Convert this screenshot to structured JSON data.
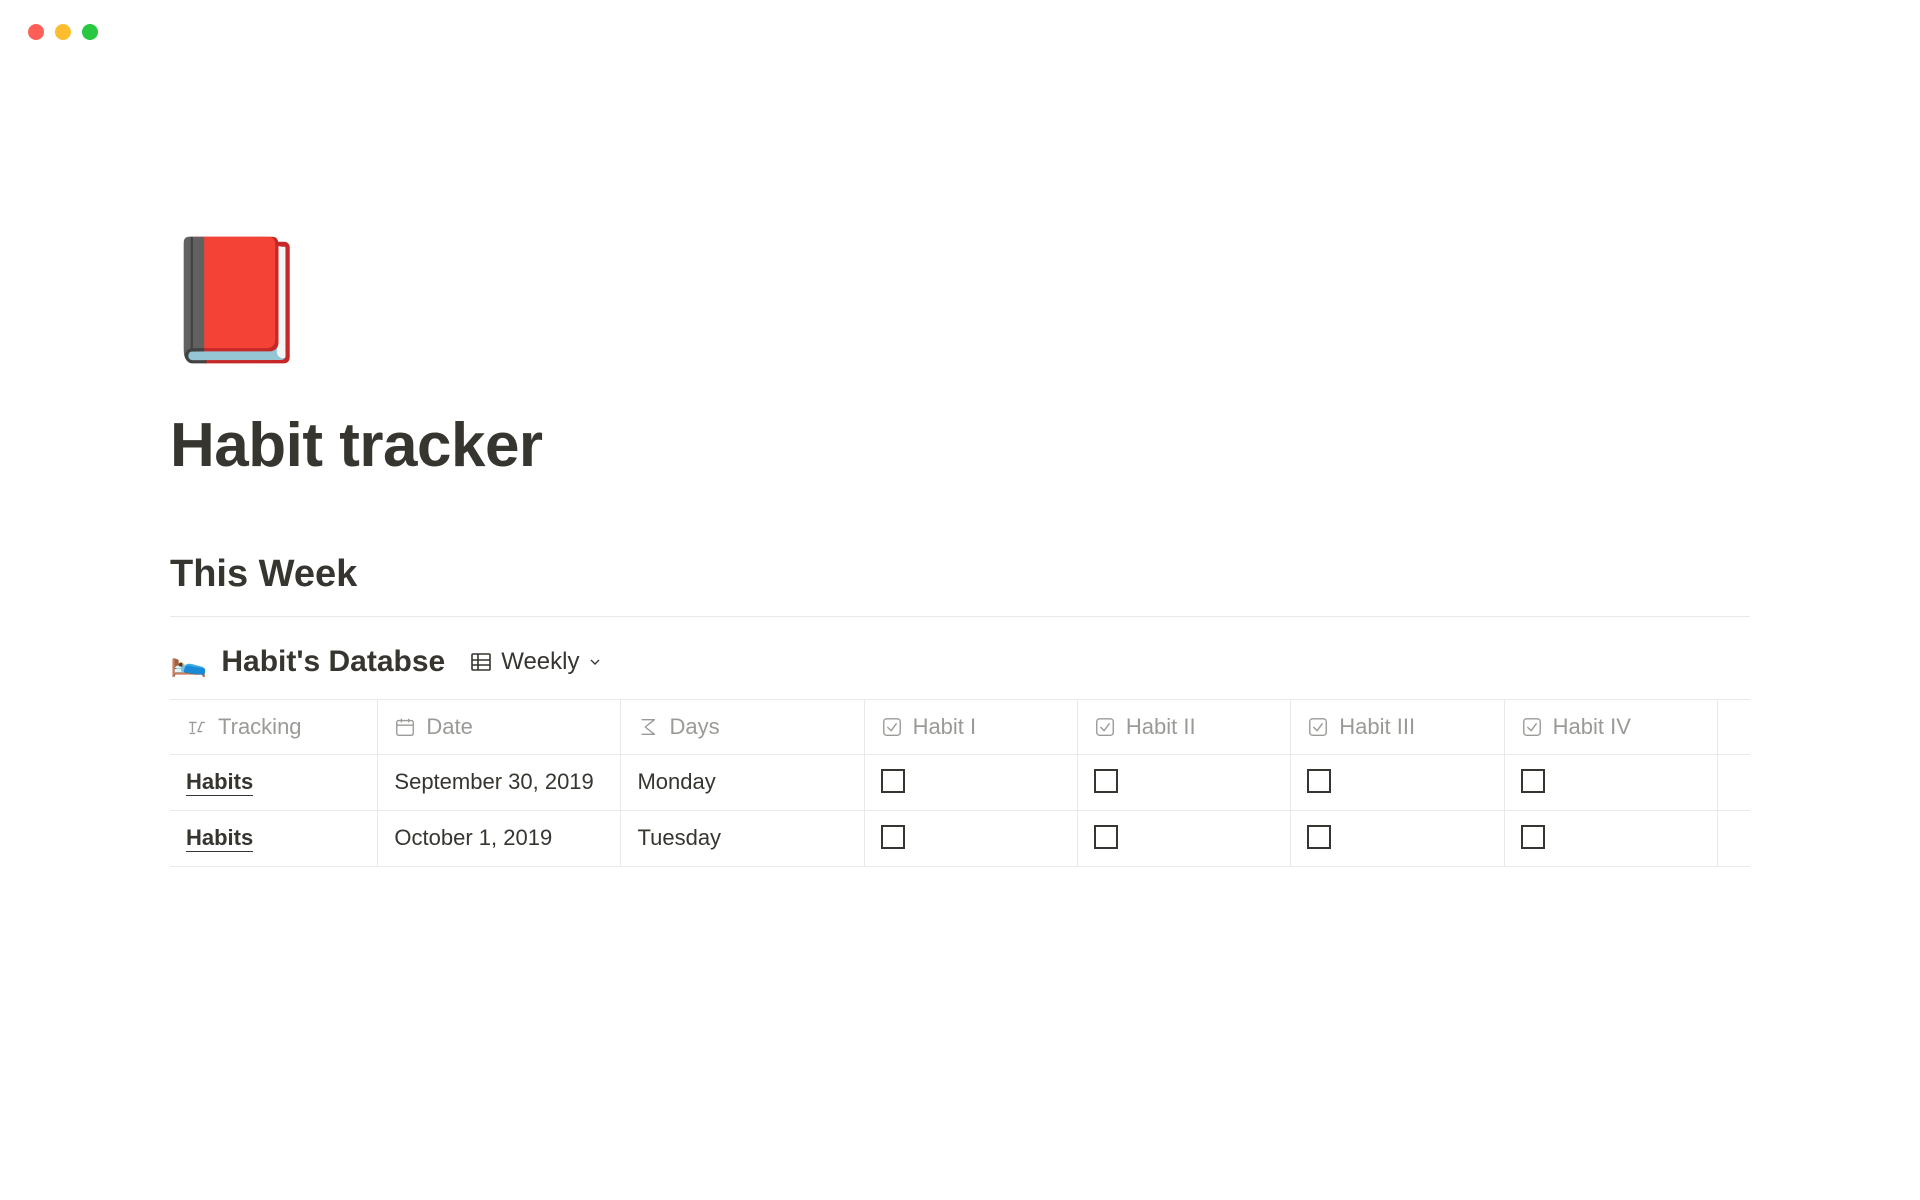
{
  "page": {
    "icon": "📕",
    "title": "Habit tracker"
  },
  "section": {
    "heading": "This Week"
  },
  "database": {
    "icon": "🛌",
    "title": "Habit's Databse",
    "view_label": "Weekly",
    "columns": {
      "tracking": "Tracking",
      "date": "Date",
      "days": "Days",
      "habit1": "Habit I",
      "habit2": "Habit II",
      "habit3": "Habit III",
      "habit4": "Habit IV"
    },
    "rows": [
      {
        "tracking": "Habits",
        "date": "September 30, 2019",
        "days": "Monday",
        "habit1": false,
        "habit2": false,
        "habit3": false,
        "habit4": false
      },
      {
        "tracking": "Habits",
        "date": "October 1, 2019",
        "days": "Tuesday",
        "habit1": false,
        "habit2": false,
        "habit3": false,
        "habit4": false
      }
    ]
  }
}
